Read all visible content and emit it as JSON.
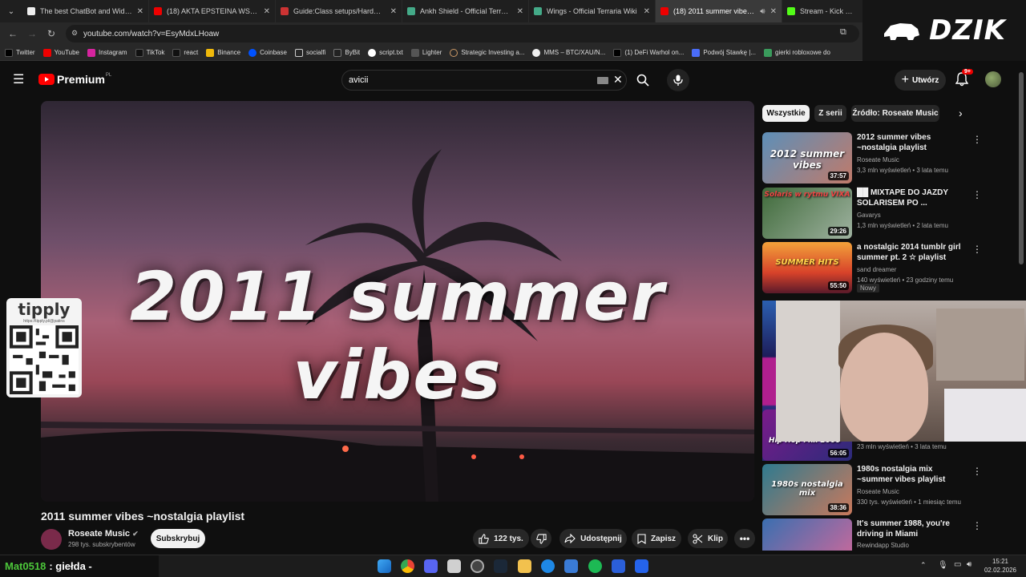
{
  "browser": {
    "tabs": [
      {
        "title": "The best ChatBot and Widgets",
        "active": false
      },
      {
        "title": "(18) AKTA EPSTEINA WSTRZĄSĄ",
        "active": false
      },
      {
        "title": "Guide:Class setups/Hardmode",
        "active": false
      },
      {
        "title": "Ankh Shield - Official Terraria W",
        "active": false
      },
      {
        "title": "Wings - Official Terraria Wiki",
        "active": false
      },
      {
        "title": "(18) 2011 summer vibes ~n",
        "active": true
      },
      {
        "title": "Stream - Kick Dashboa",
        "active": false
      }
    ],
    "url": "youtube.com/watch?v=EsyMdxLHoaw",
    "bookmarks": [
      "Twitter",
      "YouTube",
      "Instagram",
      "TikTok",
      "react",
      "Binance",
      "Coinbase",
      "socialfi",
      "ByBit",
      "script.txt",
      "Lighter",
      "Strategic Investing a...",
      "MMS – BTC/XAU/N...",
      "(1) DeFi Warhol on...",
      "Podwój Stawkę |...",
      "gierki robloxowe do"
    ]
  },
  "overlay_logo": "DZIK",
  "youtube": {
    "logo": "Premium",
    "logo_region": "PL",
    "search_value": "avicii",
    "create_label": "Utwórz",
    "notif_count": "9+",
    "chips": [
      "Wszystkie",
      "Z serii",
      "Źródło: Roseate Music"
    ],
    "video": {
      "overlay_title": "2011 summer vibes",
      "title": "2011 summer vibes ~nostalgia playlist",
      "channel": "Roseate Music",
      "subscribers": "298 tys. subskrybentów",
      "subscribe_label": "Subskrybuj",
      "likes": "122 tys.",
      "share_label": "Udostępnij",
      "save_label": "Zapisz",
      "clip_label": "Klip"
    },
    "tipply": {
      "logo": "tipply",
      "url": "https://tipply.pl/@patins"
    },
    "recommendations": [
      {
        "thumb_text": "2012 summer vibes",
        "duration": "37:57",
        "title": "2012 summer vibes ~nostalgia playlist",
        "channel": "Roseate Music",
        "meta": "3,3 mln wyświetleń • 3 lata temu",
        "color1": "#5d8fb8",
        "color2": "#c07a6a"
      },
      {
        "thumb_text": "Solaris w rytmu VIXA",
        "duration": "29:26",
        "title": "██ MIXTAPE DO JAZDY SOLARISEM PO ...",
        "channel": "Gavarys",
        "meta": "1,3 mln wyświetleń • 2 lata temu",
        "color1": "#3f6a3a",
        "color2": "#9fb2a0"
      },
      {
        "thumb_text": "SUMMER HITS",
        "duration": "55:50",
        "title": "a nostalgic 2014 tumblr girl summer pt. 2 ☆ playlist",
        "channel": "sand dreamer",
        "meta": "140 wyświetleń • 23 godziny temu",
        "badge": "Nowy",
        "color1": "#d8422a",
        "color2": "#f2a23a"
      },
      {
        "thumb_text": "Hip Hop Mix 2000",
        "duration": "56:05",
        "title": "",
        "channel": "",
        "meta": "23 mln wyświetleń • 3 lata temu",
        "color1": "#7a1b8a",
        "color2": "#2b2b7a"
      },
      {
        "thumb_text": "1980s nostalgia mix",
        "duration": "38:36",
        "title": "1980s nostalgia mix ~summer vibes playlist",
        "channel": "Roseate Music",
        "meta": "330 tys. wyświetleń • 1 miesiąc temu",
        "color1": "#2f7a8f",
        "color2": "#c9795c"
      },
      {
        "thumb_text": "",
        "duration": "",
        "title": "It's summer 1988, you're driving in Miami",
        "channel": "Rewindapp Studio",
        "meta": "",
        "color1": "#3a6fb0",
        "color2": "#d4689a"
      }
    ]
  },
  "taskbar": {
    "stream_user": "Mat0518",
    "stream_suffix": ": giełda -",
    "time": "15:21",
    "date": "02.02.2026"
  }
}
